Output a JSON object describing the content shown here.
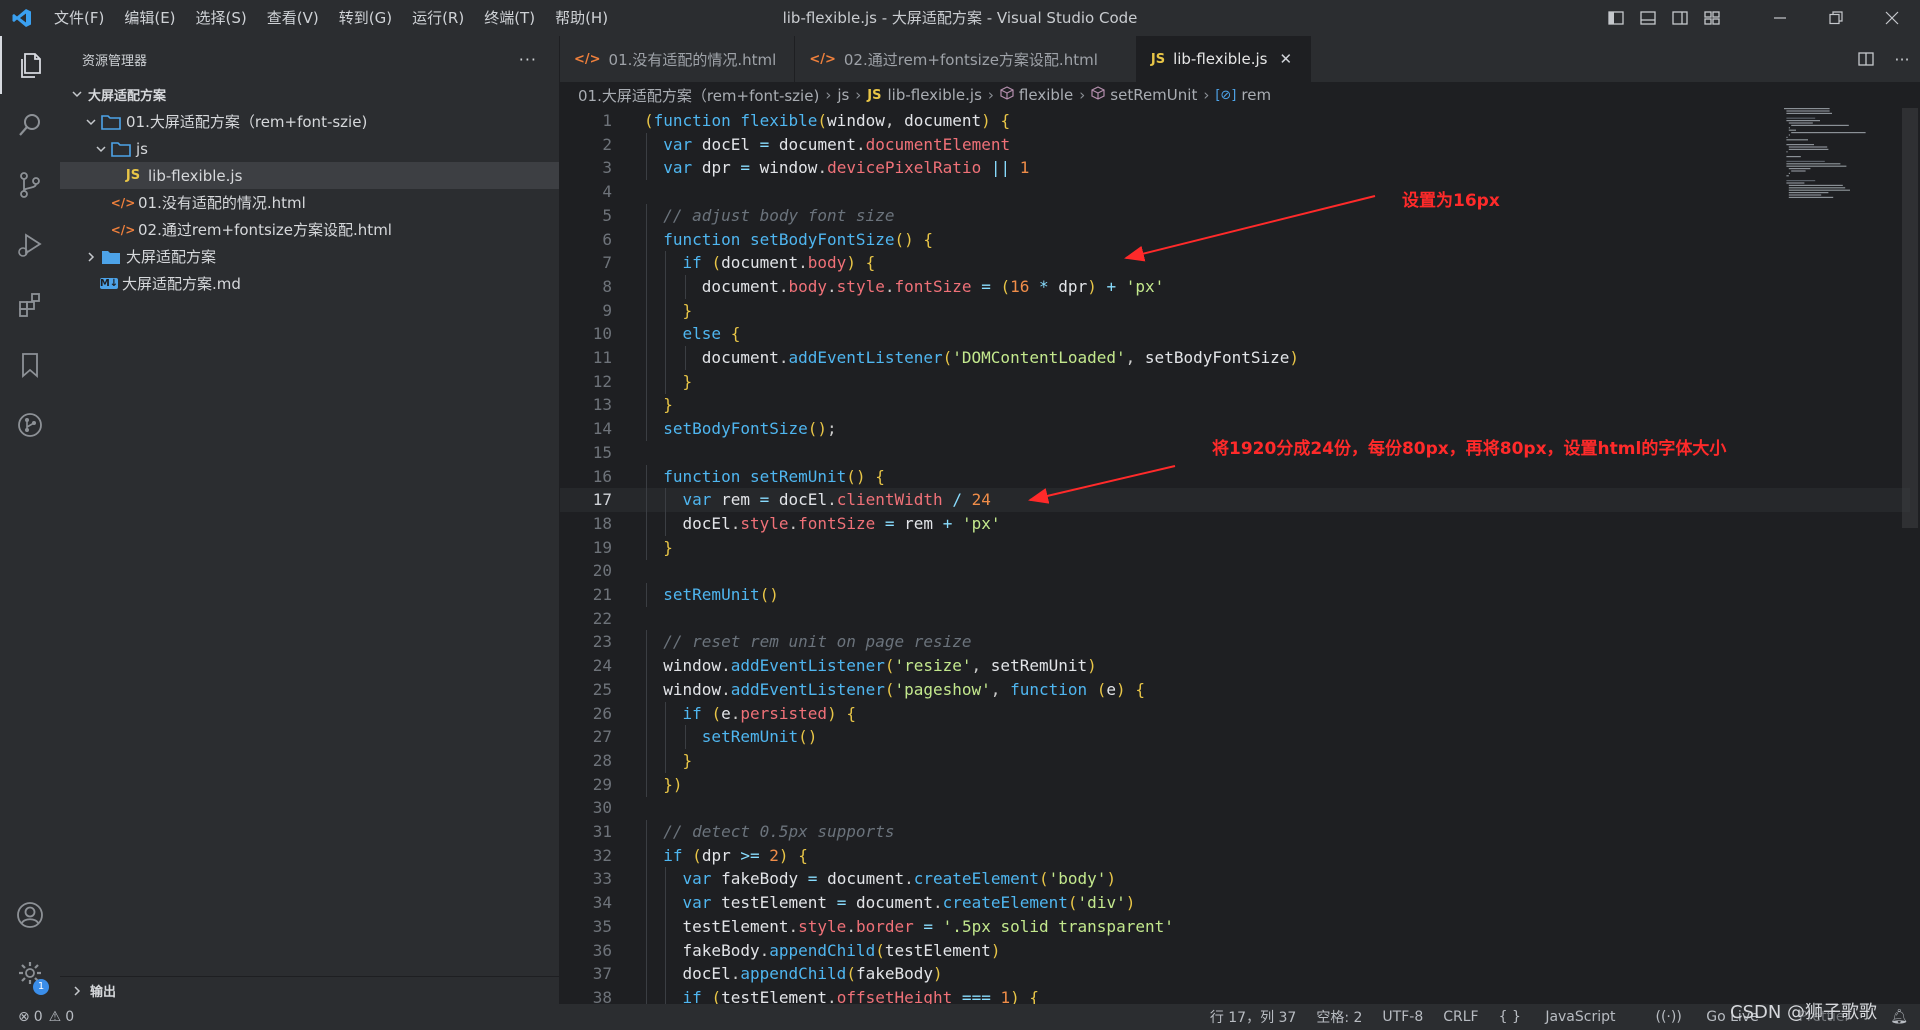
{
  "window": {
    "title": "lib-flexible.js - 大屏适配方案 - Visual Studio Code",
    "menu": [
      "文件(F)",
      "编辑(E)",
      "选择(S)",
      "查看(V)",
      "转到(G)",
      "运行(R)",
      "终端(T)",
      "帮助(H)"
    ]
  },
  "sidebar": {
    "header": "资源管理器",
    "more": "···",
    "section_title": "大屏适配方案",
    "tree": [
      {
        "label": "01.大屏适配方案（rem+font-szie)",
        "type": "folder"
      },
      {
        "label": "js",
        "type": "folder"
      },
      {
        "label": "lib-flexible.js",
        "type": "js",
        "badge": "JS"
      },
      {
        "label": "01.没有适配的情况.html",
        "type": "html",
        "badge": "</>"
      },
      {
        "label": "02.通过rem+fontsize方案设配.html",
        "type": "html",
        "badge": "</>"
      },
      {
        "label": "大屏适配方案",
        "type": "folder"
      },
      {
        "label": "大屏适配方案.md",
        "type": "md",
        "badge": "M↓"
      }
    ],
    "output_section": "输出"
  },
  "tabs": [
    {
      "label": "01.没有适配的情况.html",
      "icon": "</>"
    },
    {
      "label": "02.通过rem+fontsize方案设配.html",
      "icon": "</>"
    },
    {
      "label": "lib-flexible.js",
      "icon": "JS",
      "close": "✕"
    }
  ],
  "breadcrumb": [
    "01.大屏适配方案（rem+font-szie)",
    "js",
    "lib-flexible.js",
    "flexible",
    "setRemUnit",
    "rem"
  ],
  "breadcrumb_badges": {
    "js": "JS"
  },
  "code": {
    "current_line": 17,
    "lines": [
      "(function flexible(window, document) {",
      "  var docEl = document.documentElement",
      "  var dpr = window.devicePixelRatio || 1",
      "",
      "  // adjust body font size",
      "  function setBodyFontSize() {",
      "    if (document.body) {",
      "      document.body.style.fontSize = (16 * dpr) + 'px'",
      "    }",
      "    else {",
      "      document.addEventListener('DOMContentLoaded', setBodyFontSize)",
      "    }",
      "  }",
      "  setBodyFontSize();",
      "",
      "  function setRemUnit() {",
      "    var rem = docEl.clientWidth / 24",
      "    docEl.style.fontSize = rem + 'px'",
      "  }",
      "",
      "  setRemUnit()",
      "",
      "  // reset rem unit on page resize",
      "  window.addEventListener('resize', setRemUnit)",
      "  window.addEventListener('pageshow', function (e) {",
      "    if (e.persisted) {",
      "      setRemUnit()",
      "    }",
      "  })",
      "",
      "  // detect 0.5px supports",
      "  if (dpr >= 2) {",
      "    var fakeBody = document.createElement('body')",
      "    var testElement = document.createElement('div')",
      "    testElement.style.border = '.5px solid transparent'",
      "    fakeBody.appendChild(testElement)",
      "    docEl.appendChild(fakeBody)",
      "    if (testElement.offsetHeight === 1) {"
    ]
  },
  "annotations": {
    "note1": "设置为16px",
    "note2": "将1920分成24份，每份80px，再将80px，设置html的字体大小",
    "color": "#ff2a2a"
  },
  "statusbar": {
    "errors": "0",
    "warnings": "0",
    "position": "行 17，列 37",
    "spaces": "空格: 2",
    "encoding": "UTF-8",
    "eol": "CRLF",
    "language": "JavaScript",
    "golive": "Go Live",
    "prettier": "Prettier",
    "settings_badge": "1"
  },
  "watermark": "CSDN @狮子歌歌",
  "colors": {
    "accent": "#4fb6f0",
    "background": "#1e1f22",
    "chrome": "#2b2d30"
  }
}
